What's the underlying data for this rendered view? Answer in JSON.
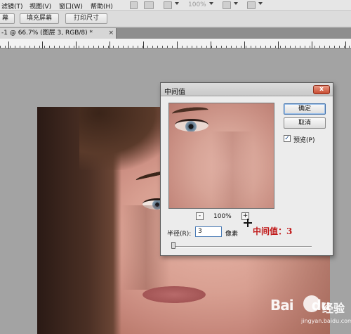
{
  "menubar": {
    "items": [
      "滤镜(T)",
      "视图(V)",
      "窗口(W)",
      "帮助(H)"
    ],
    "zoom": "100%"
  },
  "options_bar": {
    "buttons": [
      "幕",
      "填充屏幕",
      "打印尺寸"
    ]
  },
  "document_tab": {
    "title": "-1 @ 66.7% (图层 3, RGB/8) *",
    "close": "×"
  },
  "dialog": {
    "title": "中间值",
    "close_glyph": "x",
    "ok_label": "确定",
    "cancel_label": "取消",
    "preview_label": "预览(P)",
    "preview_checked": true,
    "check_glyph": "✓",
    "zoom_minus": "-",
    "zoom_plus": "+",
    "zoom_value": "100%",
    "radius_label": "半径(R):",
    "radius_value": "3",
    "radius_unit": "像素",
    "slider_value": 3
  },
  "annotation": "中间值：3",
  "watermark": {
    "logo": "Bai",
    "logo2": "du",
    "text": "经验",
    "url": "jingyan.baidu.com"
  },
  "colors": {
    "annotation": "#c01818",
    "default_button_border": "#3d6ea8"
  }
}
